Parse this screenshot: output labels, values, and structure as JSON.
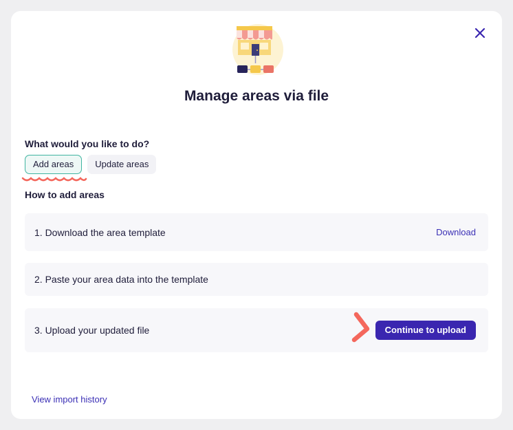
{
  "modal": {
    "title": "Manage areas via file",
    "close_icon": "close-icon",
    "illustration": "storefront-network-illustration"
  },
  "choice": {
    "question": "What would you like to do?",
    "options": [
      {
        "label": "Add areas",
        "selected": true
      },
      {
        "label": "Update areas",
        "selected": false
      }
    ]
  },
  "instructions": {
    "heading": "How to add areas",
    "steps": [
      {
        "text": "1. Download the area template",
        "action": "Download"
      },
      {
        "text": "2. Paste your area data into the template"
      },
      {
        "text": "3. Upload your updated file",
        "action": "Continue to upload"
      }
    ]
  },
  "footer": {
    "history_link": "View import history"
  },
  "colors": {
    "accent": "#3a26b0",
    "link": "#3a2fb5",
    "selected_border": "#3fb4a0",
    "annotation": "#f4675c"
  }
}
